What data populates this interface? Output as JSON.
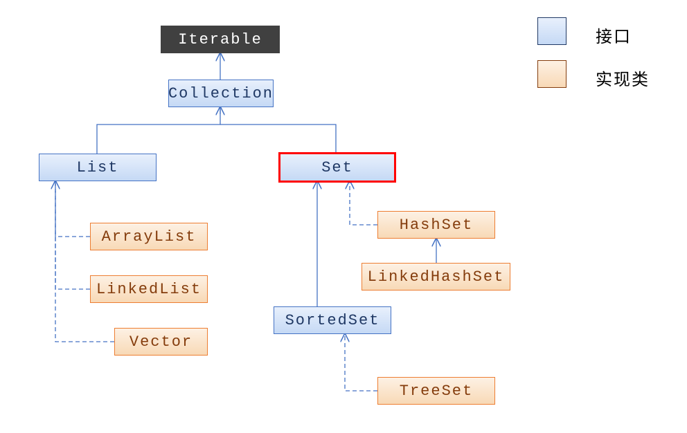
{
  "legend": {
    "interface_label": "接口",
    "impl_label": "实现类"
  },
  "nodes": {
    "iterable": "Iterable",
    "collection": "Collection",
    "list": "List",
    "set": "Set",
    "arraylist": "ArrayList",
    "linkedlist": "LinkedList",
    "vector": "Vector",
    "hashset": "HashSet",
    "linkedhashset": "LinkedHashSet",
    "sortedset": "SortedSet",
    "treeset": "TreeSet"
  },
  "chart_data": {
    "type": "hierarchy",
    "title": "Java Collection Framework Hierarchy",
    "legend": [
      {
        "label": "接口",
        "meaning": "interface",
        "color": "#c5d9f5"
      },
      {
        "label": "实现类",
        "meaning": "implementation class",
        "color": "#f8d9b6"
      }
    ],
    "highlighted": [
      "Set"
    ],
    "nodes": [
      {
        "id": "Iterable",
        "kind": "root"
      },
      {
        "id": "Collection",
        "kind": "interface"
      },
      {
        "id": "List",
        "kind": "interface"
      },
      {
        "id": "Set",
        "kind": "interface",
        "highlighted": true
      },
      {
        "id": "SortedSet",
        "kind": "interface"
      },
      {
        "id": "ArrayList",
        "kind": "implementation"
      },
      {
        "id": "LinkedList",
        "kind": "implementation"
      },
      {
        "id": "Vector",
        "kind": "implementation"
      },
      {
        "id": "HashSet",
        "kind": "implementation"
      },
      {
        "id": "LinkedHashSet",
        "kind": "implementation"
      },
      {
        "id": "TreeSet",
        "kind": "implementation"
      }
    ],
    "edges": [
      {
        "from": "Collection",
        "to": "Iterable",
        "relation": "extends",
        "style": "solid"
      },
      {
        "from": "List",
        "to": "Collection",
        "relation": "extends",
        "style": "solid"
      },
      {
        "from": "Set",
        "to": "Collection",
        "relation": "extends",
        "style": "solid"
      },
      {
        "from": "ArrayList",
        "to": "List",
        "relation": "implements",
        "style": "dashed"
      },
      {
        "from": "LinkedList",
        "to": "List",
        "relation": "implements",
        "style": "dashed"
      },
      {
        "from": "Vector",
        "to": "List",
        "relation": "implements",
        "style": "dashed"
      },
      {
        "from": "HashSet",
        "to": "Set",
        "relation": "implements",
        "style": "dashed"
      },
      {
        "from": "SortedSet",
        "to": "Set",
        "relation": "extends",
        "style": "solid"
      },
      {
        "from": "LinkedHashSet",
        "to": "HashSet",
        "relation": "extends",
        "style": "solid"
      },
      {
        "from": "TreeSet",
        "to": "SortedSet",
        "relation": "implements",
        "style": "dashed"
      }
    ]
  }
}
